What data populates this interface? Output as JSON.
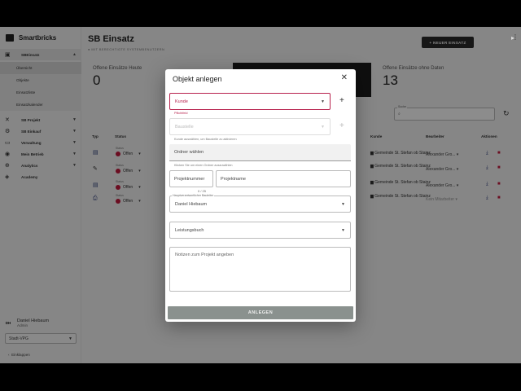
{
  "sidebar": {
    "brand": "Smartbricks",
    "nav": [
      {
        "label": "SBEinsatz",
        "icon": "calendar-icon",
        "glyph": "▣"
      },
      {
        "label": "SB Projekt",
        "icon": "tools-icon",
        "glyph": "✕"
      },
      {
        "label": "SB Einkauf",
        "icon": "gear-icon",
        "glyph": "⚙"
      },
      {
        "label": "Verwaltung",
        "icon": "folder-icon",
        "glyph": "▭"
      },
      {
        "label": "Mein Betrieb",
        "icon": "chat-icon",
        "glyph": "◉"
      },
      {
        "label": "Analytics",
        "icon": "globe-icon",
        "glyph": "⊕"
      },
      {
        "label": "Academy",
        "icon": "book-icon",
        "glyph": "◈"
      }
    ],
    "sub_items": [
      "Übersicht",
      "Objekte",
      "Einsatzliste",
      "Einsatzkalender"
    ],
    "user": {
      "initials": "DH",
      "name": "Daniel Hiebaum",
      "role": "Admin"
    },
    "tenant": "Stadt-VPG",
    "collapse": "Einklappen"
  },
  "main": {
    "title": "SB Einsatz",
    "subtitle": "● MIT BERECHTIGTE SYSTEMBENUTZERN",
    "new_button": "+ NEUER EINSATZ",
    "stats": [
      {
        "label": "Offene Einsätze Heute",
        "value": "0"
      },
      {
        "label": "Offene Einsätze ohne Daten",
        "value": "13"
      }
    ],
    "search_label": "Suche",
    "search_placeholder": "",
    "columns": [
      "Typ",
      "Status",
      "Kunde",
      "Bearbeiter",
      "Aktionen"
    ],
    "rows": [
      {
        "status_label": "Status",
        "status": "Offen",
        "customer": "Gemeinde St. Stefan ob Stainz",
        "owner": "Alexander Gro..."
      },
      {
        "status_label": "Status",
        "status": "Offen",
        "customer": "Gemeinde St. Stefan ob Stainz",
        "owner": "Alexander Gro..."
      },
      {
        "status_label": "Status",
        "status": "Offen",
        "customer": "Gemeinde St. Stefan ob Stainz",
        "owner": "Alexander Gro..."
      },
      {
        "status_label": "Status",
        "status": "Offen",
        "customer": "Gemeinde St. Stefan ob Stainz",
        "owner": "Kein Mitarbeiter"
      }
    ]
  },
  "dialog": {
    "title": "Objekt anlegen",
    "kunde": {
      "label": "Kunde",
      "helper": "Pflichtfeld"
    },
    "baustelle": {
      "label": "Baustelle",
      "helper": "Kunde auswählen, um Baustelle zu aktivieren"
    },
    "ordner": {
      "label": "Ordner wählen",
      "helper": "Klicken Sie um einen Ordner auszuwählen"
    },
    "projektnummer": {
      "label": "Projektnummer",
      "counter": "0 / 25"
    },
    "projektname": {
      "label": "Projektname"
    },
    "bauleiter": {
      "label": "Hauptverantwortlicher Bauleiter",
      "value": "Daniel Hiebaum"
    },
    "leistungsbuch": {
      "label": "Leistungsbuch"
    },
    "notes_placeholder": "Notizen zum Projekt angeben",
    "submit": "ANLEGEN"
  },
  "colors": {
    "error": "#b8224e",
    "status_dot": "#c4183c",
    "submit_disabled": "#8a918e"
  }
}
